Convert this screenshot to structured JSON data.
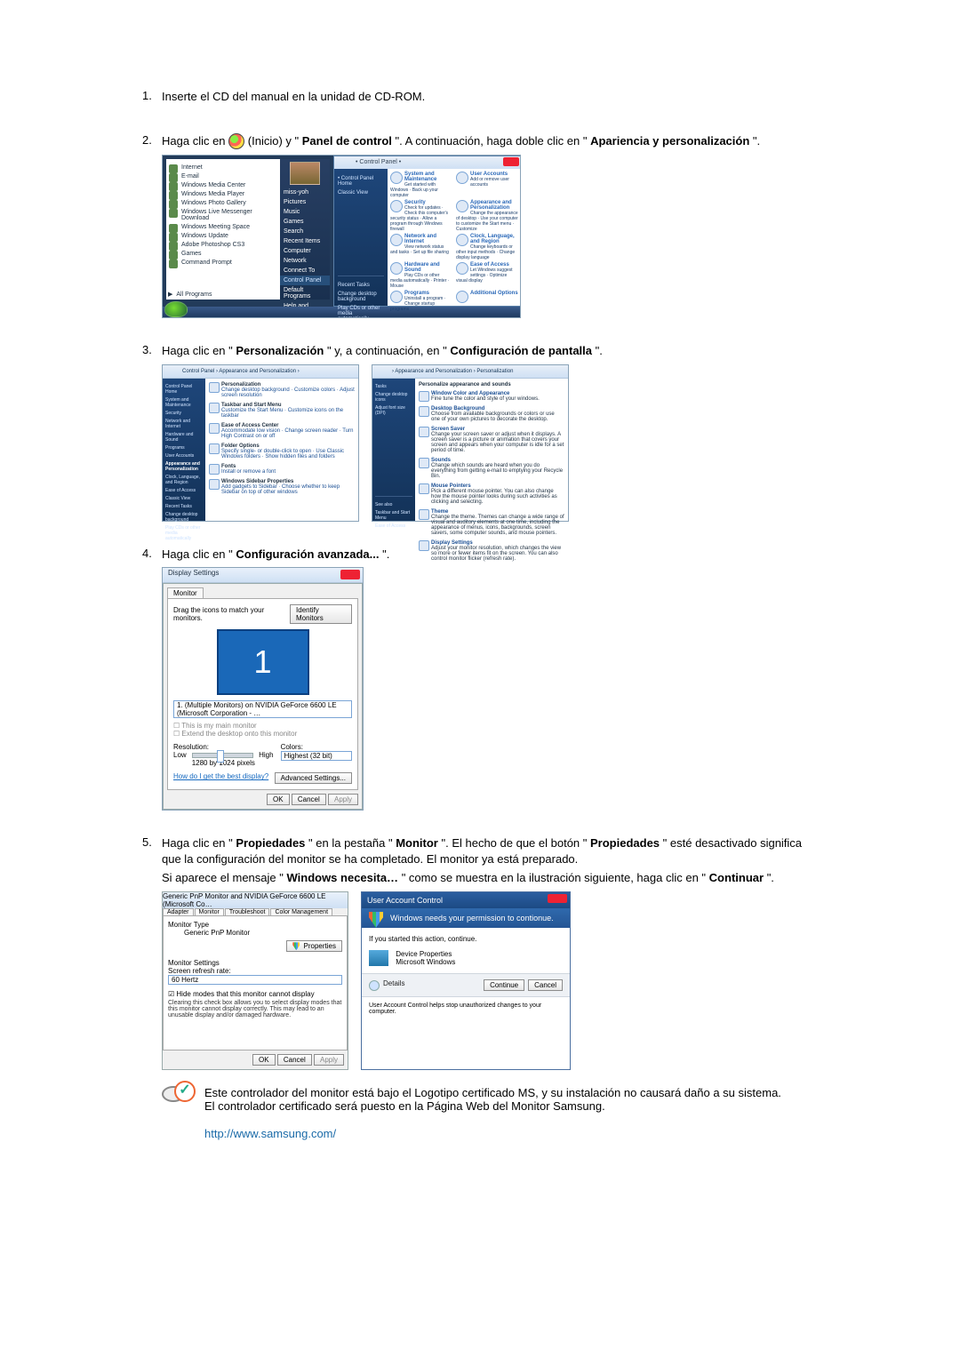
{
  "step1": {
    "num": "1.",
    "text": "Inserte el CD del manual en la unidad de CD-ROM."
  },
  "step2": {
    "num": "2.",
    "pre": "Haga clic en ",
    "icon_alt": "Inicio",
    "mid1": "(Inicio) y \"",
    "b1": "Panel de control",
    "mid2": "\". A continuación, haga doble clic en \"",
    "b2": "Apariencia y personalización",
    "post": "\".",
    "start_left": [
      "Internet",
      "E-mail",
      "Windows Media Center",
      "Windows Media Player",
      "Windows Photo Gallery",
      "Windows Live Messenger Download",
      "Windows Meeting Space",
      "Windows Update",
      "Adobe Photoshop CS3",
      "Games",
      "Command Prompt"
    ],
    "all_programs": "All Programs",
    "start_right": [
      "miss-yoh",
      "Pictures",
      "Music",
      "Games",
      "Search",
      "Recent Items",
      "Computer",
      "Network",
      "Connect To",
      "Control Panel",
      "Default Programs",
      "Help and Support"
    ],
    "cp_nav": "• Control Panel •",
    "cp_side": [
      "• Control Panel Home",
      "Classic View"
    ],
    "cp_cats": [
      {
        "h": "System and Maintenance",
        "s": "Get started with Windows · Back up your computer"
      },
      {
        "h": "User Accounts",
        "s": "Add or remove user accounts"
      },
      {
        "h": "Security",
        "s": "Check for updates · Check this computer's security status · Allow a program through Windows firewall"
      },
      {
        "h": "Appearance and Personalization",
        "s": "Change the appearance of desktop · Use your computer to customize the Start menu · Customize"
      },
      {
        "h": "Network and Internet",
        "s": "View network status and tasks · Set up file sharing"
      },
      {
        "h": "Clock, Language, and Region",
        "s": "Change keyboards or other input methods · Change display language"
      },
      {
        "h": "Hardware and Sound",
        "s": "Play CDs or other media automatically · Printer · Mouse"
      },
      {
        "h": "Ease of Access",
        "s": "Let Windows suggest settings · Optimize visual display"
      },
      {
        "h": "Programs",
        "s": "Uninstall a program · Change startup programs"
      },
      {
        "h": "Additional Options",
        "s": ""
      }
    ],
    "cp_sidebox": [
      "Recent Tasks",
      "Change desktop background",
      "Play CDs or other media automatically"
    ]
  },
  "step3": {
    "num": "3.",
    "pre": "Haga clic en \"",
    "b1": "Personalización",
    "mid": "\" y, a continuación, en \"",
    "b2": "Configuración de pantalla",
    "post": "\".",
    "left_nav": "Control Panel › Appearance and Personalization ›",
    "left_side": [
      "Control Panel Home",
      "System and Maintenance",
      "Security",
      "Network and Internet",
      "Hardware and Sound",
      "Programs",
      "User Accounts",
      "Appearance and Personalization",
      "Clock, Language, and Region",
      "Ease of Access",
      "Classic View",
      "Recent Tasks",
      "Change desktop background",
      "Play CDs or other media automatically"
    ],
    "left_items": [
      {
        "h": "Personalization",
        "s": "Change desktop background · Customize colors · Adjust screen resolution"
      },
      {
        "h": "Taskbar and Start Menu",
        "s": "Customize the Start Menu · Customize icons on the taskbar"
      },
      {
        "h": "Ease of Access Center",
        "s": "Accommodate low vision · Change screen reader · Turn High Contrast on or off"
      },
      {
        "h": "Folder Options",
        "s": "Specify single- or double-click to open · Use Classic Windows folders · Show hidden files and folders"
      },
      {
        "h": "Fonts",
        "s": "Install or remove a font"
      },
      {
        "h": "Windows Sidebar Properties",
        "s": "Add gadgets to Sidebar · Choose whether to keep Sidebar on top of other windows"
      }
    ],
    "right_nav": "› Appearance and Personalization › Personalization",
    "right_side": [
      "Tasks",
      "Change desktop icons",
      "Adjust font size (DPI)"
    ],
    "right_side_bottom": [
      "See also",
      "Taskbar and Start Menu",
      "Ease of Access"
    ],
    "right_title": "Personalize appearance and sounds",
    "right_items": [
      {
        "h": "Window Color and Appearance",
        "s": "Fine tune the color and style of your windows."
      },
      {
        "h": "Desktop Background",
        "s": "Choose from available backgrounds or colors or use one of your own pictures to decorate the desktop."
      },
      {
        "h": "Screen Saver",
        "s": "Change your screen saver or adjust when it displays. A screen saver is a picture or animation that covers your screen and appears when your computer is idle for a set period of time."
      },
      {
        "h": "Sounds",
        "s": "Change which sounds are heard when you do everything from getting e-mail to emptying your Recycle Bin."
      },
      {
        "h": "Mouse Pointers",
        "s": "Pick a different mouse pointer. You can also change how the mouse pointer looks during such activities as clicking and selecting."
      },
      {
        "h": "Theme",
        "s": "Change the theme. Themes can change a wide range of visual and auditory elements at one time, including the appearance of menus, icons, backgrounds, screen savers, some computer sounds, and mouse pointers."
      },
      {
        "h": "Display Settings",
        "s": "Adjust your monitor resolution, which changes the view so more or fewer items fit on the screen. You can also control monitor flicker (refresh rate)."
      }
    ]
  },
  "step4": {
    "num": "4.",
    "pre": "Haga clic en \"",
    "b1": "Configuración avanzada...",
    "post": "\".",
    "title": "Display Settings",
    "tab": "Monitor",
    "drag": "Drag the icons to match your monitors.",
    "identify": "Identify Monitors",
    "mon_num": "1",
    "sel": "1. (Multiple Monitors) on NVIDIA GeForce 6600 LE (Microsoft Corporation - …",
    "chk_main": "This is my main monitor",
    "chk_ext": "Extend the desktop onto this monitor",
    "res_lbl": "Resolution:",
    "low": "Low",
    "high": "High",
    "res_val": "1280 by 1024 pixels",
    "col_lbl": "Colors:",
    "col_val": "Highest (32 bit)",
    "help": "How do I get the best display?",
    "adv": "Advanced Settings...",
    "ok": "OK",
    "cancel": "Cancel",
    "apply": "Apply"
  },
  "step5": {
    "num": "5.",
    "pre": "Haga clic en \"",
    "b1": "Propiedades",
    "mid1": "\" en la pestaña \"",
    "b2": "Monitor",
    "mid2": "\". El hecho de que el botón \"",
    "b3": "Propiedades",
    "mid3": "\" esté desactivado significa que la configuración del monitor se ha completado. El monitor ya está preparado.",
    "line2_pre": "Si aparece el mensaje \"",
    "b4": "Windows necesita…",
    "line2_mid": "\" como se muestra en la ilustración siguiente, haga clic en  \"",
    "b5": "Continuar",
    "line2_post": "\".",
    "props_title": "Generic PnP Monitor and NVIDIA GeForce 6600 LE (Microsoft Co…",
    "props_tabs": [
      "Adapter",
      "Monitor",
      "Troubleshoot",
      "Color Management"
    ],
    "props_mt": "Monitor Type",
    "props_mt_v": "Generic PnP Monitor",
    "props_btn": "Properties",
    "props_ms": "Monitor Settings",
    "props_sr": "Screen refresh rate:",
    "props_sr_v": "60 Hertz",
    "props_hide": "Hide modes that this monitor cannot display",
    "props_hint": "Clearing this check box allows you to select display modes that this monitor cannot display correctly. This may lead to an unusable display and/or damaged hardware.",
    "ok": "OK",
    "cancel": "Cancel",
    "apply": "Apply",
    "uac_title": "User Account Control",
    "uac_band": "Windows needs your permission to contionue.",
    "uac_if": "If you started this action, continue.",
    "uac_dev": "Device Properties",
    "uac_mw": "Microsoft Windows",
    "uac_det": "Details",
    "uac_cont": "Continue",
    "uac_can": "Cancel",
    "uac_foot": "User Account Control helps stop unauthorized changes to your computer."
  },
  "note": {
    "l1": "Este controlador del monitor está bajo el Logotipo certificado MS, y su instalación no causará daño a su sistema.",
    "l2": "El controlador certificado será puesto en la Página Web del Monitor Samsung.",
    "url": "http://www.samsung.com/"
  }
}
